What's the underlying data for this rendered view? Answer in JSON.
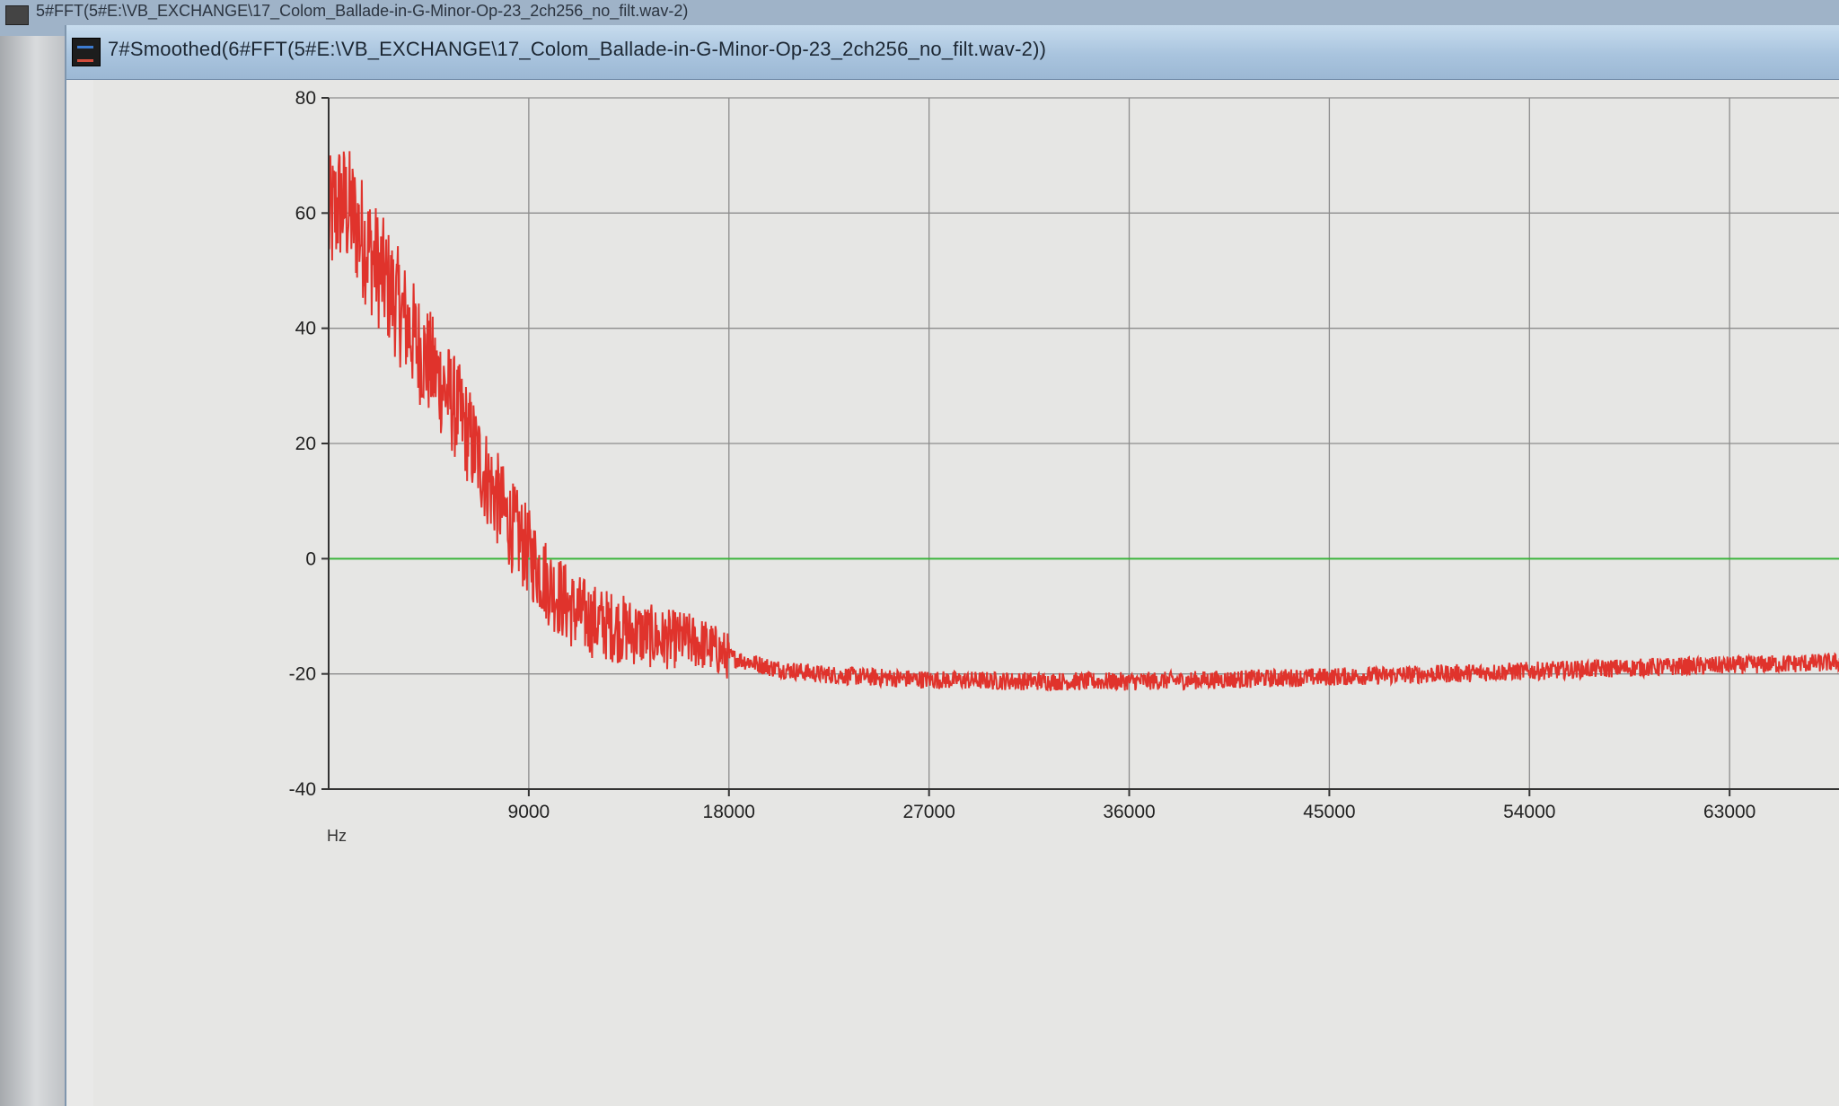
{
  "background_window": {
    "title": "5#FFT(5#E:\\VB_EXCHANGE\\17_Colom_Ballade-in-G-Minor-Op-23_2ch256_no_filt.wav-2)"
  },
  "window": {
    "title": "7#Smoothed(6#FFT(5#E:\\VB_EXCHANGE\\17_Colom_Ballade-in-G-Minor-Op-23_2ch256_no_filt.wav-2))",
    "icon": "chart-app-icon"
  },
  "colors": {
    "series": "#e0332c",
    "zero_line": "#3bb43b",
    "grid": "#8c8c8c",
    "plot_bg": "#e6e6e4",
    "titlebar": "#a9c4de"
  },
  "chart_data": {
    "type": "line",
    "title": "",
    "xlabel": "Hz",
    "ylabel": "",
    "xlim": [
      0,
      68000
    ],
    "ylim": [
      -40,
      80
    ],
    "x_ticks": [
      "9000",
      "18000",
      "27000",
      "36000",
      "45000",
      "54000",
      "63000"
    ],
    "x_tick_values": [
      9000,
      18000,
      27000,
      36000,
      45000,
      54000,
      63000
    ],
    "y_ticks": [
      "80",
      "60",
      "40",
      "20",
      "0",
      "-20",
      "-40"
    ],
    "y_tick_values": [
      80,
      60,
      40,
      20,
      0,
      -20,
      -40
    ],
    "grid": true,
    "reference_line": {
      "y": 0,
      "color": "#3bb43b"
    },
    "series": [
      {
        "color": "#e0332c",
        "x": [
          0,
          500,
          1000,
          2000,
          3000,
          4000,
          5000,
          6000,
          7000,
          8000,
          9000,
          10000,
          11000,
          12000,
          13000,
          14000,
          15000,
          16000,
          17000,
          18000,
          19000,
          20000,
          22000,
          24000,
          27000,
          30000,
          33000,
          36000,
          40000,
          45000,
          50000,
          54000,
          58000,
          63000,
          68000
        ],
        "y": [
          58,
          62,
          60,
          52,
          45,
          37,
          31,
          24,
          15,
          7,
          1,
          -5,
          -9,
          -11,
          -12,
          -13,
          -14,
          -14,
          -15,
          -17,
          -18,
          -19,
          -20,
          -20.5,
          -21,
          -21.2,
          -21.3,
          -21.3,
          -21,
          -20.5,
          -20,
          -19.5,
          -19,
          -18.5,
          -18
        ]
      }
    ]
  }
}
